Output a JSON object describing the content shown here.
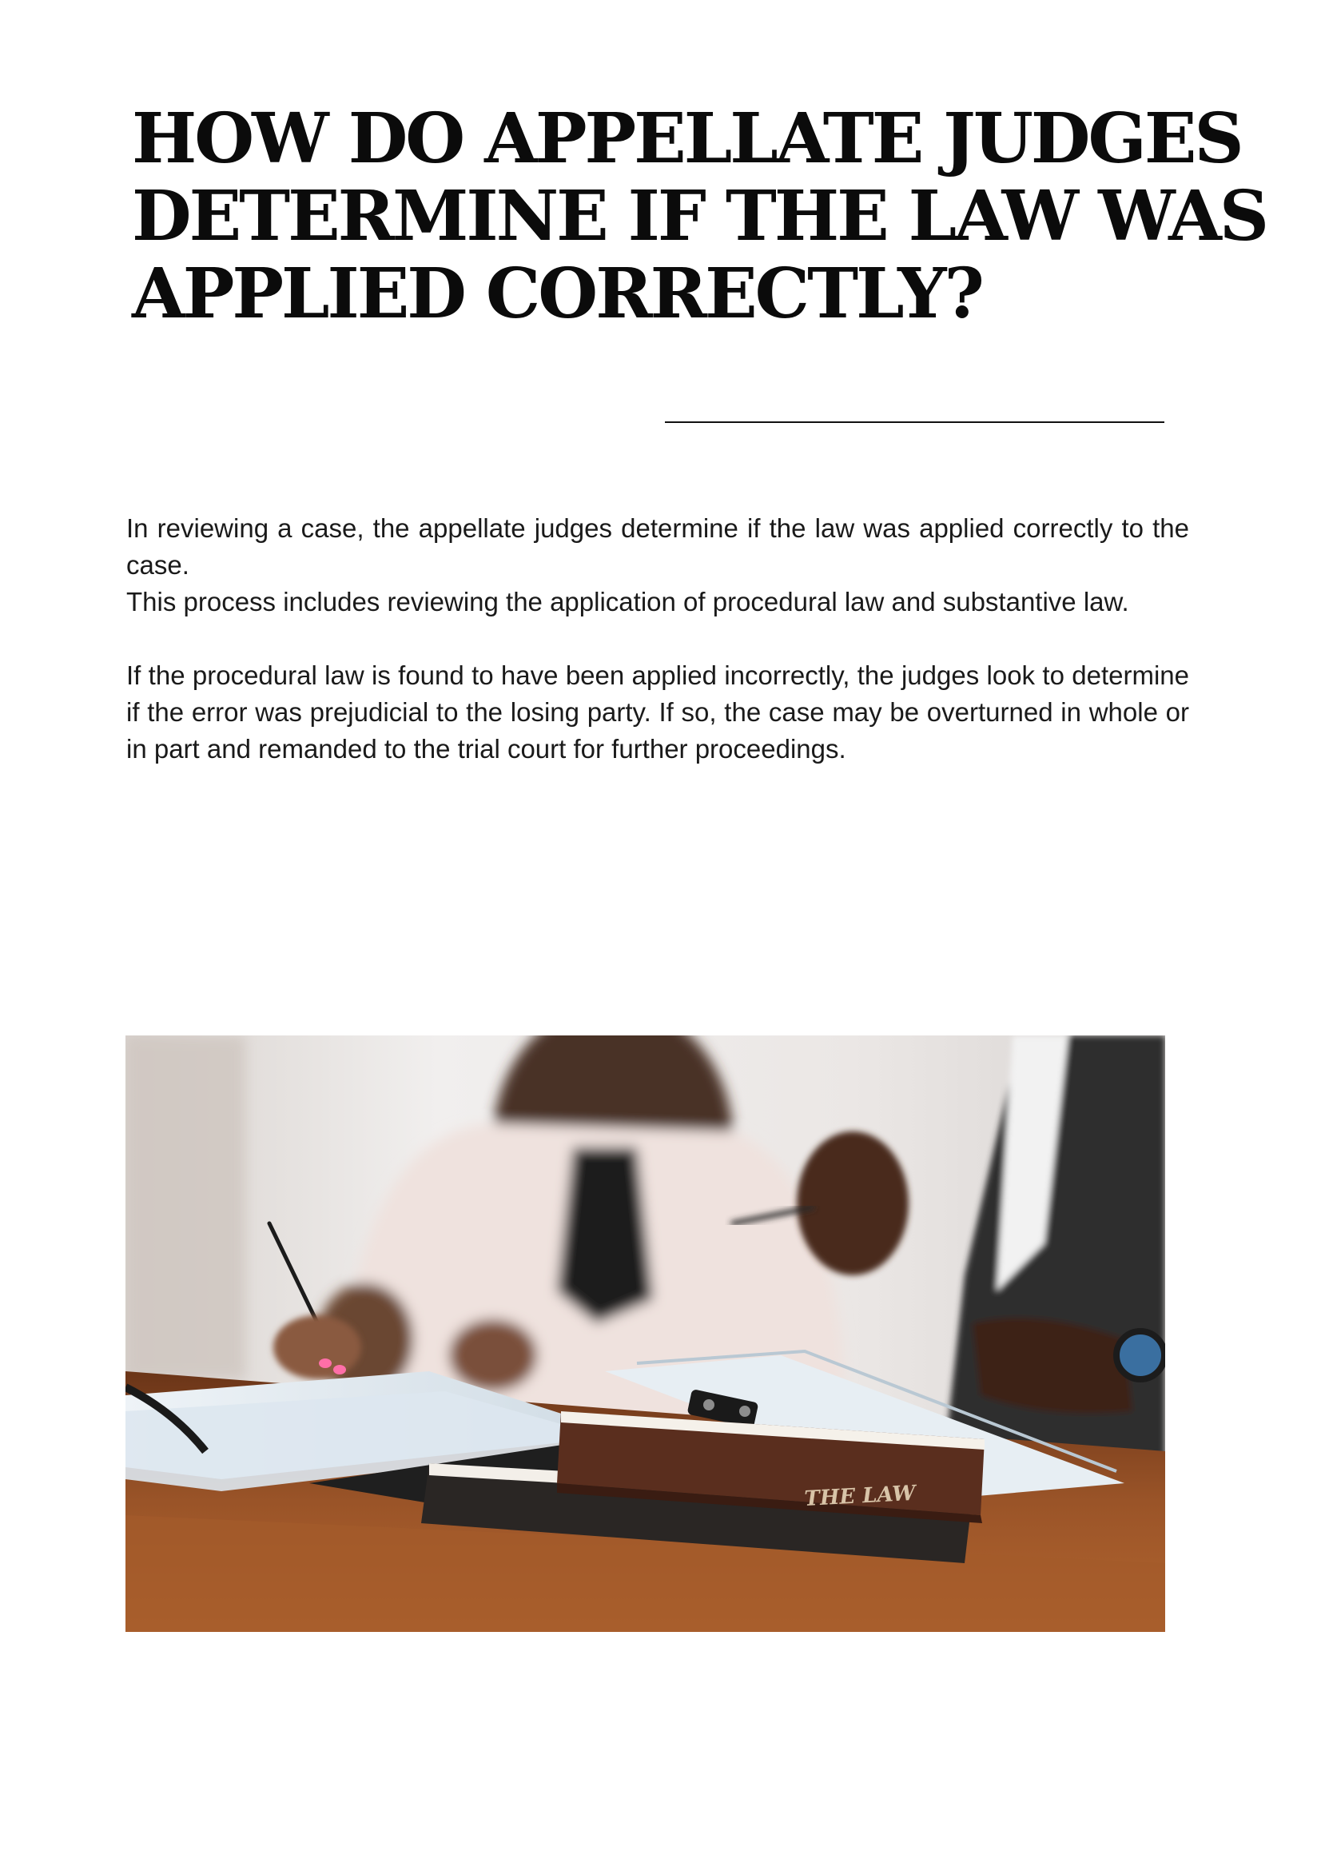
{
  "title_lines": [
    "HOW DO APPELLATE JUDGES",
    "DETERMINE IF THE LAW WAS",
    "APPLIED CORRECTLY?"
  ],
  "paragraphs": [
    "In reviewing a case, the appellate judges determine if the law was applied correctly to the case.",
    "This process includes reviewing the application of procedural law and substantive law.",
    "If the procedural law is found to have been applied incorrectly, the judges look to determine if the error was prejudicial to the losing party. If so, the case may be overturned in whole or in part and remanded to the trial court for further proceedings."
  ],
  "photo": {
    "book_spine_text": "THE LAW"
  },
  "colors": {
    "text": "#111111",
    "desk_wood": "#8a4a22",
    "book_brown": "#5a2e1e",
    "blazer_light": "#efe0dc",
    "suit_dark": "#2b2b2b"
  }
}
